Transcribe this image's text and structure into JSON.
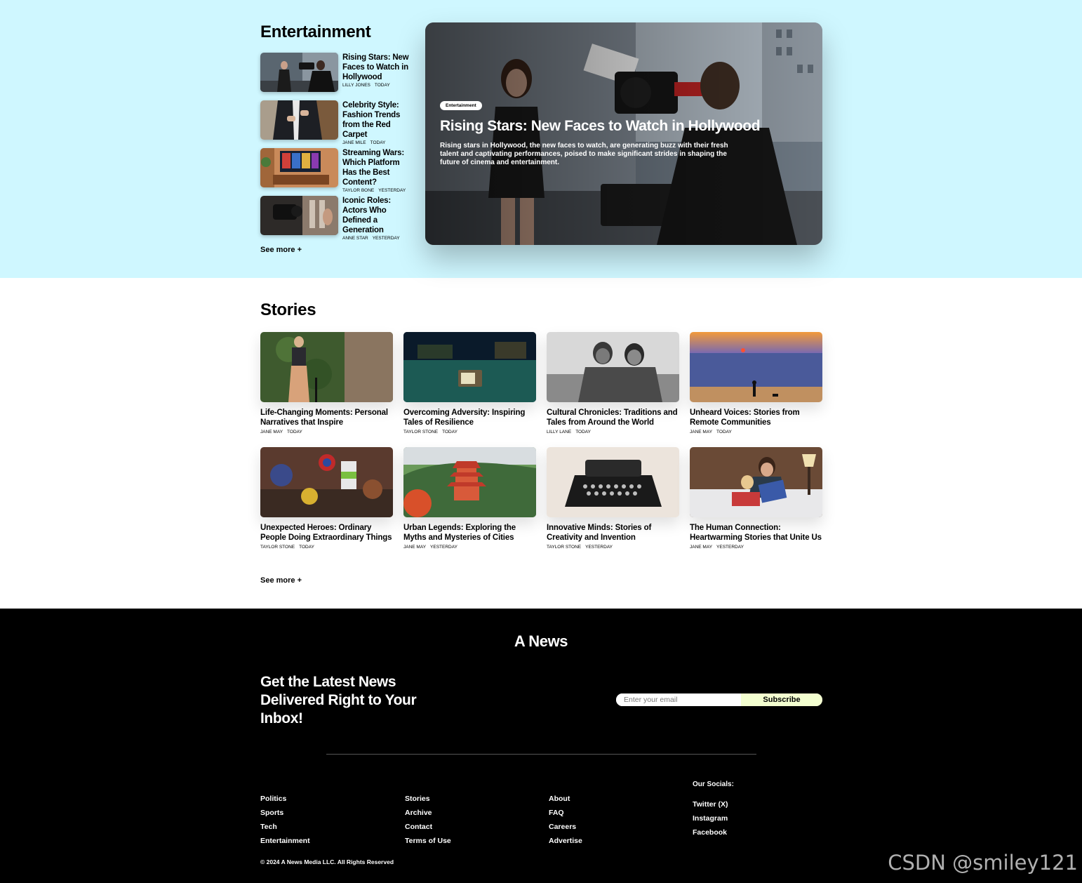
{
  "entertainment": {
    "title": "Entertainment",
    "items": [
      {
        "headline": "Rising Stars: New Faces to Watch in Hollywood",
        "author": "LILLY JONES",
        "time": "TODAY",
        "image": "film-set-thumb"
      },
      {
        "headline": "Celebrity Style: Fashion Trends from the Red Carpet",
        "author": "JANE MILE",
        "time": "TODAY",
        "image": "suit-thumb"
      },
      {
        "headline": "Streaming Wars: Which Platform Has the Best Content?",
        "author": "TAYLOR BONE",
        "time": "YESTERDAY",
        "image": "tv-room-thumb"
      },
      {
        "headline": "Iconic Roles: Actors Who Defined a Generation",
        "author": "ANNE STAR",
        "time": "YESTERDAY",
        "image": "camera-thumb"
      }
    ],
    "see_more": "See more +",
    "featured": {
      "tag": "Entertainment",
      "title": "Rising Stars: New Faces to Watch in Hollywood",
      "description": "Rising stars in Hollywood, the new faces to watch, are generating buzz with their fresh talent and captivating performances, poised to make significant strides in shaping the future of cinema and entertainment."
    }
  },
  "stories": {
    "title": "Stories",
    "items": [
      {
        "headline": "Life-Changing Moments: Personal Narratives that Inspire",
        "author": "JANE MAY",
        "time": "TODAY"
      },
      {
        "headline": "Overcoming Adversity: Inspiring Tales of Resilience",
        "author": "TAYLOR STONE",
        "time": "TODAY"
      },
      {
        "headline": "Cultural Chronicles: Traditions and Tales from Around the World",
        "author": "LILLY LANE",
        "time": "TODAY"
      },
      {
        "headline": "Unheard Voices: Stories from Remote Communities",
        "author": "JANE MAY",
        "time": "TODAY"
      },
      {
        "headline": "Unexpected Heroes: Ordinary People Doing Extraordinary Things",
        "author": "TAYLOR STONE",
        "time": "TODAY"
      },
      {
        "headline": "Urban Legends: Exploring the Myths and Mysteries of Cities",
        "author": "JANE MAY",
        "time": "YESTERDAY"
      },
      {
        "headline": "Innovative Minds: Stories of Creativity and Invention",
        "author": "TAYLOR STONE",
        "time": "YESTERDAY"
      },
      {
        "headline": "The Human Connection: Heartwarming Stories that Unite Us",
        "author": "JANE MAY",
        "time": "YESTERDAY"
      }
    ],
    "see_more": "See more +"
  },
  "footer": {
    "brand": "A News",
    "newsletter_title": "Get the Latest News Delivered Right to Your Inbox!",
    "email_placeholder": "Enter your email",
    "subscribe_label": "Subscribe",
    "columns": [
      [
        "Politics",
        "Sports",
        "Tech",
        "Entertainment"
      ],
      [
        "Stories",
        "Archive",
        "Contact",
        "Terms of Use"
      ],
      [
        "About",
        "FAQ",
        "Careers",
        "Advertise"
      ]
    ],
    "socials_title": "Our Socials:",
    "socials": [
      "Twitter (X)",
      "Instagram",
      "Facebook"
    ],
    "copyright": "© 2024 A News Media LLC. All Rights Reserved"
  },
  "watermark": "CSDN @smiley121",
  "colors": {
    "entertainment_bg": "#cff7ff",
    "footer_bg": "#000000",
    "subscribe_bg": "#f4ffd0"
  }
}
